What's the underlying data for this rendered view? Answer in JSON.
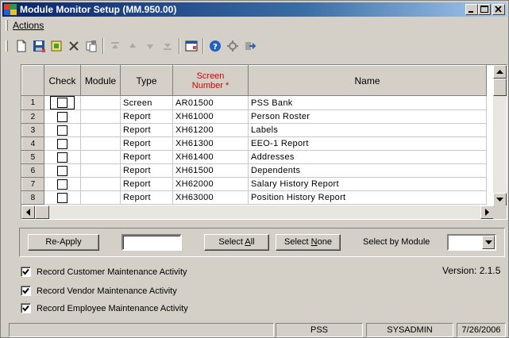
{
  "window": {
    "title": "Module Monitor Setup (MM.950.00)",
    "controls": [
      "minimize",
      "maximize",
      "close"
    ]
  },
  "menu": {
    "actions_label": "Actions"
  },
  "toolbar": {
    "icons": [
      "new-icon",
      "save-icon",
      "copy-icon",
      "delete-icon",
      "paste-icon",
      "first-icon",
      "prev-icon",
      "next-icon",
      "last-icon",
      "window-icon",
      "help-icon",
      "tools-icon",
      "exit-icon"
    ]
  },
  "grid": {
    "headers": {
      "check": "Check",
      "module": "Module",
      "type": "Type",
      "screen_number_line1": "Screen",
      "screen_number_line2": "Number *",
      "name": "Name"
    },
    "rows": [
      {
        "num": "1",
        "module": "",
        "type": "Screen",
        "screen": "AR01500",
        "name": "PSS Bank"
      },
      {
        "num": "2",
        "module": "",
        "type": "Report",
        "screen": "XH61000",
        "name": "Person Roster"
      },
      {
        "num": "3",
        "module": "",
        "type": "Report",
        "screen": "XH61200",
        "name": "Labels"
      },
      {
        "num": "4",
        "module": "",
        "type": "Report",
        "screen": "XH61300",
        "name": "EEO-1 Report"
      },
      {
        "num": "5",
        "module": "",
        "type": "Report",
        "screen": "XH61400",
        "name": "Addresses"
      },
      {
        "num": "6",
        "module": "",
        "type": "Report",
        "screen": "XH61500",
        "name": "Dependents"
      },
      {
        "num": "7",
        "module": "",
        "type": "Report",
        "screen": "XH62000",
        "name": "Salary History Report"
      },
      {
        "num": "8",
        "module": "",
        "type": "Report",
        "screen": "XH63000",
        "name": "Position History Report"
      }
    ]
  },
  "controls": {
    "reapply_label": "Re-Apply",
    "reapply_value": "",
    "select_all_prefix": "Select ",
    "select_all_key": "A",
    "select_all_suffix": "ll",
    "select_none_prefix": "Select ",
    "select_none_key": "N",
    "select_none_suffix": "one",
    "select_by_module_label": "Select by Module",
    "select_by_module_value": ""
  },
  "options": [
    {
      "label": "Record Customer Maintenance Activity",
      "checked": true
    },
    {
      "label": "Record Vendor Maintenance Activity",
      "checked": true
    },
    {
      "label": "Record Employee Maintenance Activity",
      "checked": true
    }
  ],
  "version": "Version: 2.1.5",
  "status": {
    "pane1": "",
    "pane2": "PSS",
    "pane3": "SYSADMIN",
    "pane4": "7/26/2006"
  }
}
